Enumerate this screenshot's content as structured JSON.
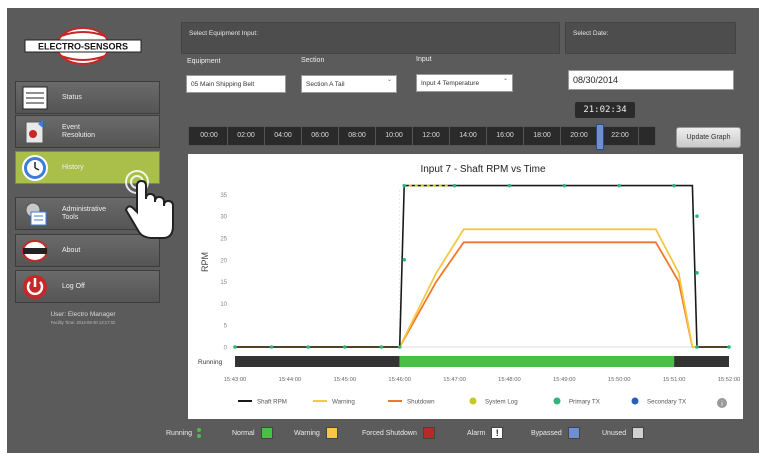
{
  "sidebar": {
    "logo_text": "ELECTRO-SENSORS",
    "items": [
      {
        "label": "Status",
        "icon": "status-icon"
      },
      {
        "label": "Event Resolution",
        "icon": "event-resolution-icon"
      },
      {
        "label": "History",
        "icon": "history-clock-icon",
        "active": true
      },
      {
        "label": "Administrative Tools",
        "icon": "administrative-tools-icon"
      },
      {
        "label": "About",
        "icon": "about-icon"
      },
      {
        "label": "Log Off",
        "icon": "power-icon"
      }
    ],
    "user_line": "User:  Electro Manager",
    "facility_line": "Facility Time: 2014-08-30 13:17:02"
  },
  "equipment_section": {
    "title": "Select Equipment Input:",
    "equipment_label": "Equipment",
    "equipment_value": "05 Main Shipping Belt",
    "section_label": "Section",
    "section_value": "Section A Tail",
    "input_label": "Input",
    "input_value": "Input 4 Temperature"
  },
  "date_section": {
    "title": "Select Date:",
    "date_value": "08/30/2014"
  },
  "timeline": {
    "ticks": [
      "00:00",
      "02:00",
      "04:00",
      "06:00",
      "08:00",
      "10:00",
      "12:00",
      "14:00",
      "16:00",
      "18:00",
      "20:00",
      "22:00"
    ],
    "current_time": "21:02:34",
    "update_button": "Update Graph"
  },
  "colors": {
    "rpm": "#1a1a1a",
    "warning": "#f5c842",
    "shutdown": "#f0782d",
    "system_log": "#c8c81e",
    "primary_tx": "#2cb67d",
    "secondary_tx": "#2a5fb8",
    "running_bar": "#48c048",
    "stopped_bar": "#333333"
  },
  "chart_data": {
    "type": "line",
    "title": "Input 7 - Shaft RPM vs Time",
    "ylabel": "RPM",
    "xlabel": "",
    "ylim": [
      0,
      36
    ],
    "yticks": [
      0,
      5,
      10,
      15,
      20,
      25,
      30,
      35
    ],
    "x": [
      "15:43:00",
      "15:44:00",
      "15:45:00",
      "15:46:00",
      "15:47:00",
      "15:48:00",
      "15:49:00",
      "15:50:00",
      "15:51:00",
      "15:52:00"
    ],
    "x_start": "15:43:00",
    "x_end": "15:52:00",
    "series": [
      {
        "name": "Shaft RPM",
        "color": "#1a1a1a",
        "points": [
          [
            "15:43:00",
            0
          ],
          [
            "15:46:00",
            0
          ],
          [
            "15:46:05",
            37
          ],
          [
            "15:51:20",
            37
          ],
          [
            "15:51:25",
            0
          ],
          [
            "15:52:00",
            0
          ]
        ]
      },
      {
        "name": "Warning",
        "color": "#f5c842",
        "points": [
          [
            "15:43:00",
            0
          ],
          [
            "15:46:00",
            0
          ],
          [
            "15:46:40",
            17
          ],
          [
            "15:47:10",
            27
          ],
          [
            "15:50:40",
            27
          ],
          [
            "15:51:05",
            17
          ],
          [
            "15:51:20",
            0
          ],
          [
            "15:52:00",
            0
          ]
        ]
      },
      {
        "name": "Shutdown",
        "color": "#f0782d",
        "points": [
          [
            "15:43:00",
            0
          ],
          [
            "15:46:00",
            0
          ],
          [
            "15:46:40",
            15
          ],
          [
            "15:47:10",
            24
          ],
          [
            "15:50:40",
            24
          ],
          [
            "15:51:05",
            15
          ],
          [
            "15:51:20",
            0
          ],
          [
            "15:52:00",
            0
          ]
        ]
      }
    ],
    "marker_series": [
      {
        "name": "System Log",
        "color": "#c8c81e"
      },
      {
        "name": "Primary TX",
        "color": "#2cb67d"
      },
      {
        "name": "Secondary TX",
        "color": "#2a5fb8"
      }
    ],
    "status_row": {
      "label": "Running",
      "segments": [
        {
          "from": "15:43:00",
          "to": "15:46:00",
          "state": "stopped"
        },
        {
          "from": "15:46:00",
          "to": "15:51:00",
          "state": "running"
        },
        {
          "from": "15:51:00",
          "to": "15:52:00",
          "state": "stopped"
        }
      ]
    },
    "legend": [
      "Shaft RPM",
      "Warning",
      "Shutdown",
      "System Log",
      "Primary TX",
      "Secondary TX"
    ],
    "legend_placement": "bottom",
    "grid": false
  },
  "status_legend": [
    {
      "label": "Running",
      "color": "#48c048"
    },
    {
      "label": "Normal",
      "color": "#48c048"
    },
    {
      "label": "Warning",
      "color": "#f5c842"
    },
    {
      "label": "Forced Shutdown",
      "color": "#b82a2a"
    },
    {
      "label": "Alarm",
      "color": "#ffffff"
    },
    {
      "label": "Bypassed",
      "color": "#6f8fd0"
    },
    {
      "label": "Unused",
      "color": "#d0d0d0"
    }
  ]
}
